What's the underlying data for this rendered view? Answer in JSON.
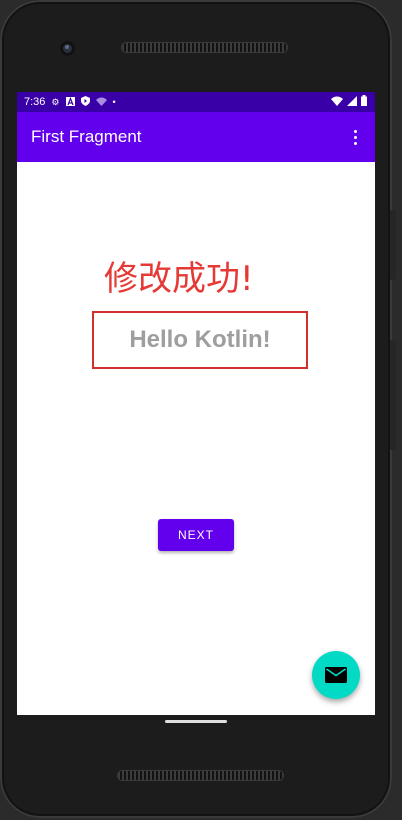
{
  "status_bar": {
    "time": "7:36",
    "left_icons": [
      "gear-icon",
      "a-icon",
      "shield-icon",
      "wifi-question-icon",
      "dot-icon"
    ],
    "right_icons": [
      "wifi-icon",
      "signal-icon",
      "battery-icon"
    ]
  },
  "app_bar": {
    "title": "First Fragment",
    "overflow_icon": "more-vert-icon"
  },
  "content": {
    "headline": "修改成功!",
    "hello_text": "Hello Kotlin!",
    "next_label": "NEXT"
  },
  "fab": {
    "icon": "mail-icon"
  },
  "colors": {
    "status_bar": "#3a00a8",
    "primary": "#6200ee",
    "accent": "#03dac5",
    "headline": "#e53935",
    "box_border": "#d32f2f",
    "hello_text": "#9e9e9e"
  }
}
